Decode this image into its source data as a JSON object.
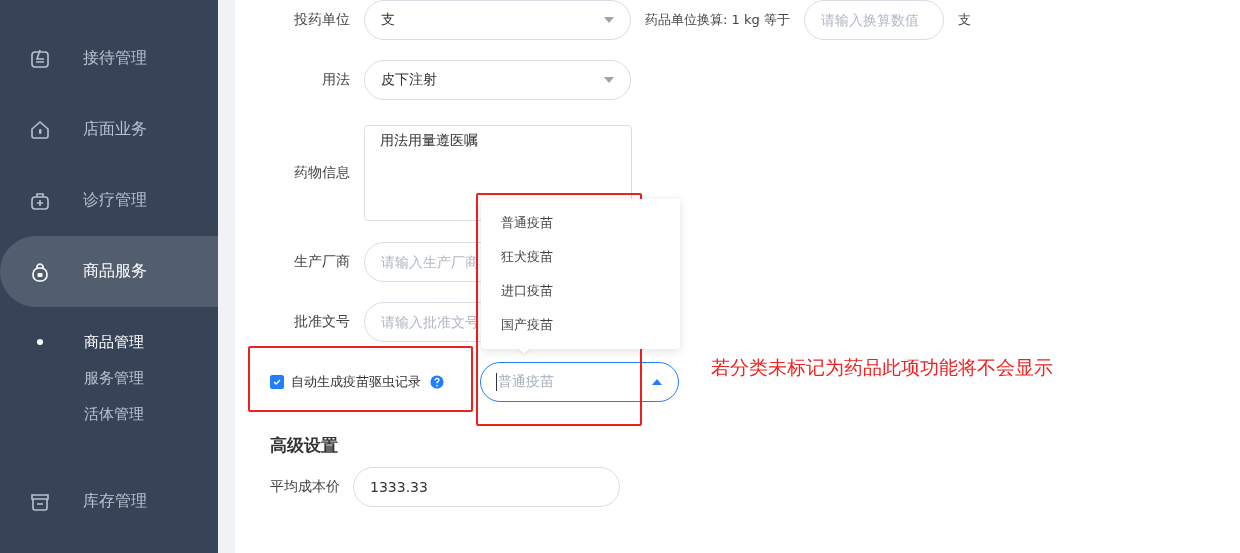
{
  "sidebar": {
    "items": [
      {
        "label": "接待管理",
        "selected": false
      },
      {
        "label": "店面业务",
        "selected": false
      },
      {
        "label": "诊疗管理",
        "selected": false
      },
      {
        "label": "商品服务",
        "selected": true,
        "children": [
          {
            "label": "商品管理",
            "selected": true
          },
          {
            "label": "服务管理",
            "selected": false
          },
          {
            "label": "活体管理",
            "selected": false
          }
        ]
      },
      {
        "label": "库存管理",
        "selected": false
      }
    ]
  },
  "form": {
    "unit_row": {
      "label": "投药单位",
      "value": "支",
      "conversion_label": "药品单位换算: 1 kg 等于",
      "conversion_placeholder": "请输入换算数值",
      "suffix": "支"
    },
    "usage": {
      "label": "用法",
      "value": "皮下注射"
    },
    "info": {
      "label": "药物信息",
      "value": "用法用量遵医嘱"
    },
    "manufacturer": {
      "label": "生产厂商",
      "placeholder": "请输入生产厂商"
    },
    "approval": {
      "label": "批准文号",
      "placeholder": "请输入批准文号"
    },
    "auto_record": {
      "label": "自动生成疫苗驱虫记录",
      "checked": true,
      "select_placeholder": "普通疫苗",
      "expanded": true,
      "options": [
        {
          "label": "普通疫苗"
        },
        {
          "label": "狂犬疫苗"
        },
        {
          "label": "进口疫苗"
        },
        {
          "label": "国产疫苗"
        }
      ]
    },
    "advanced": {
      "title": "高级设置",
      "avg_cost": {
        "label": "平均成本价",
        "value": "1333.33"
      }
    }
  },
  "annotation": {
    "text": "若分类未标记为药品此项功能将不会显示"
  }
}
